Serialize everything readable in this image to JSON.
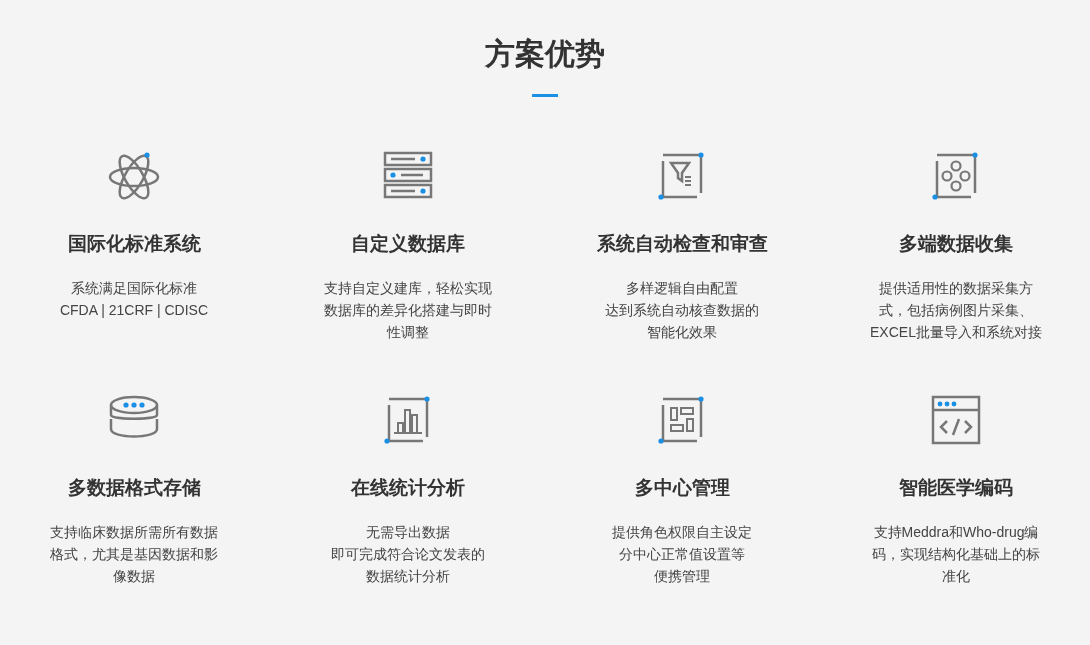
{
  "heading": "方案优势",
  "features": [
    {
      "title": "国际化标准系统",
      "lines": [
        "系统满足国际化标准",
        "CFDA | 21CRF | CDISC"
      ]
    },
    {
      "title": "自定义数据库",
      "lines": [
        "支持自定义建库，轻松实现",
        "数据库的差异化搭建与即时",
        "性调整"
      ]
    },
    {
      "title": "系统自动检查和审查",
      "lines": [
        "多样逻辑自由配置",
        "达到系统自动核查数据的",
        "智能化效果"
      ]
    },
    {
      "title": "多端数据收集",
      "lines": [
        "提供适用性的数据采集方",
        "式，包括病例图片采集、",
        "EXCEL批量导入和系统对接"
      ]
    },
    {
      "title": "多数据格式存储",
      "lines": [
        "支持临床数据所需所有数据",
        "格式，尤其是基因数据和影",
        "像数据"
      ]
    },
    {
      "title": "在线统计分析",
      "lines": [
        "无需导出数据",
        "即可完成符合论文发表的",
        "数据统计分析"
      ]
    },
    {
      "title": "多中心管理",
      "lines": [
        "提供角色权限自主设定",
        "分中心正常值设置等",
        "便携管理"
      ]
    },
    {
      "title": "智能医学编码",
      "lines": [
        "支持Meddra和Who-drug编",
        "码，实现结构化基础上的标",
        "准化"
      ]
    }
  ]
}
